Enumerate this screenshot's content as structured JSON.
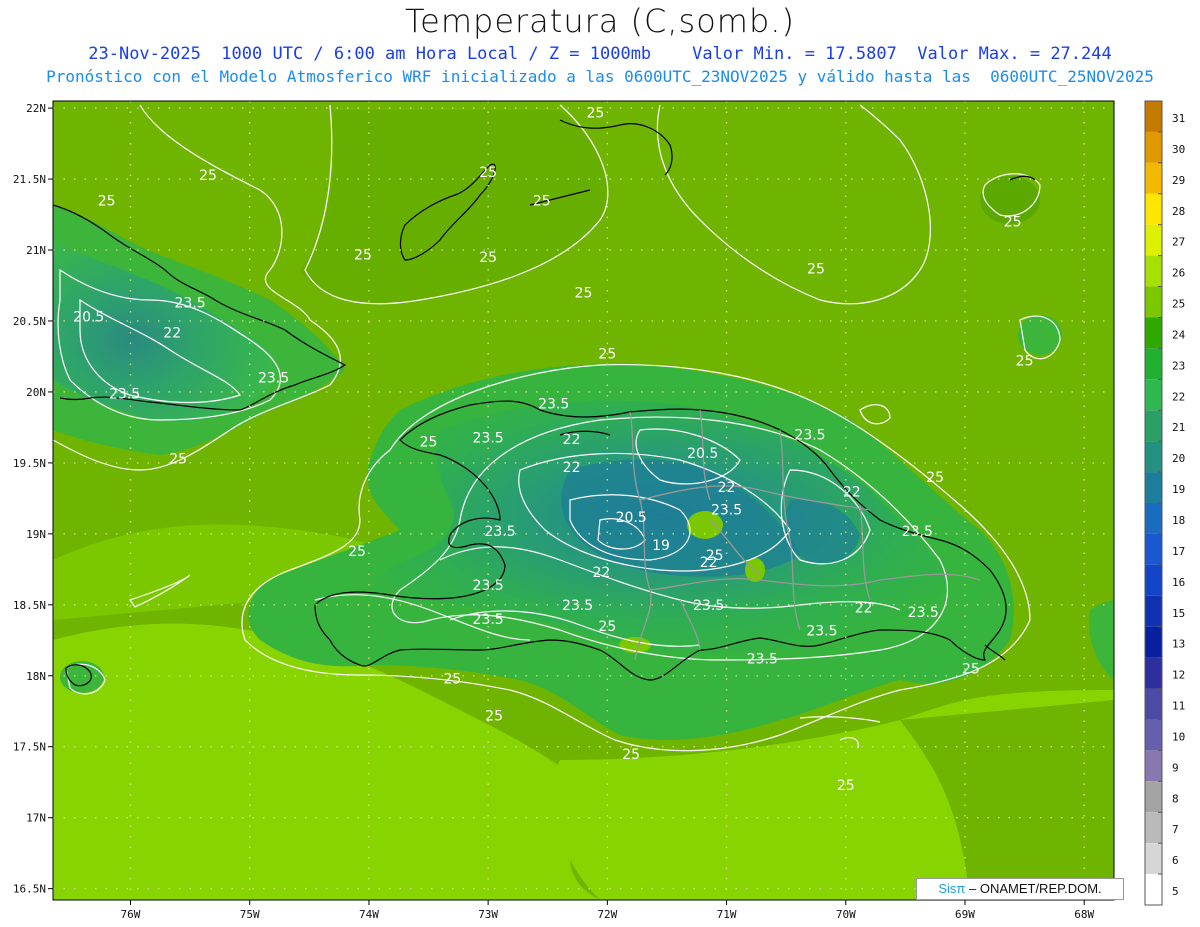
{
  "header": {
    "title": "Temperatura (C,somb.)",
    "subtitle": "23-Nov-2025  1000 UTC / 6:00 am Hora Local / Z = 1000mb    Valor Min. = 17.5807  Valor Max. = 27.244",
    "subtitle2": "Pronóstico con el Modelo Atmosferico WRF inicializado a las 0600UTC_23NOV2025 y válido hasta las  0600UTC_25NOV2025"
  },
  "credit": {
    "sis": "Sisπ",
    "text": "– ONAMET/REP.DOM."
  },
  "map": {
    "lat_labels": [
      "22N",
      "21.5N",
      "21N",
      "20.5N",
      "20N",
      "19.5N",
      "19N",
      "18.5N",
      "18N",
      "17.5N",
      "17N",
      "16.5N"
    ],
    "lon_labels": [
      "76W",
      "75W",
      "74W",
      "73W",
      "72W",
      "71W",
      "70W",
      "69W",
      "68W"
    ],
    "lat_range": [
      16.42,
      22.05
    ],
    "lon_range": [
      -76.65,
      -67.75
    ],
    "grid": true,
    "isotherm_labels": [
      {
        "text": "25",
        "lon": -72.1,
        "lat": 21.97
      },
      {
        "text": "25",
        "lon": -75.35,
        "lat": 21.53
      },
      {
        "text": "25",
        "lon": -73.0,
        "lat": 21.55
      },
      {
        "text": "25",
        "lon": -72.55,
        "lat": 21.35
      },
      {
        "text": "25",
        "lon": -76.2,
        "lat": 21.35
      },
      {
        "text": "25",
        "lon": -68.6,
        "lat": 21.2
      },
      {
        "text": "25",
        "lon": -73.0,
        "lat": 20.95
      },
      {
        "text": "25",
        "lon": -74.05,
        "lat": 20.97
      },
      {
        "text": "25",
        "lon": -70.25,
        "lat": 20.87
      },
      {
        "text": "25",
        "lon": -72.2,
        "lat": 20.7
      },
      {
        "text": "25",
        "lon": -72.0,
        "lat": 20.27
      },
      {
        "text": "25",
        "lon": -68.5,
        "lat": 20.22
      },
      {
        "text": "25",
        "lon": -75.6,
        "lat": 19.53
      },
      {
        "text": "25",
        "lon": -69.25,
        "lat": 19.4
      },
      {
        "text": "25",
        "lon": -73.5,
        "lat": 19.65
      },
      {
        "text": "25",
        "lon": -74.1,
        "lat": 18.88
      },
      {
        "text": "25",
        "lon": -72.0,
        "lat": 18.35
      },
      {
        "text": "25",
        "lon": -71.1,
        "lat": 18.85
      },
      {
        "text": "25",
        "lon": -68.95,
        "lat": 18.05
      },
      {
        "text": "25",
        "lon": -73.3,
        "lat": 17.98
      },
      {
        "text": "25",
        "lon": -72.95,
        "lat": 17.72
      },
      {
        "text": "25",
        "lon": -71.8,
        "lat": 17.45
      },
      {
        "text": "25",
        "lon": -70.0,
        "lat": 17.23
      },
      {
        "text": "23.5",
        "lon": -75.5,
        "lat": 20.63
      },
      {
        "text": "23.5",
        "lon": -74.8,
        "lat": 20.1
      },
      {
        "text": "23.5",
        "lon": -76.05,
        "lat": 19.99
      },
      {
        "text": "23.5",
        "lon": -72.45,
        "lat": 19.92
      },
      {
        "text": "23.5",
        "lon": -73.0,
        "lat": 19.68
      },
      {
        "text": "23.5",
        "lon": -70.3,
        "lat": 19.7
      },
      {
        "text": "23.5",
        "lon": -72.9,
        "lat": 19.02
      },
      {
        "text": "23.5",
        "lon": -73.0,
        "lat": 18.64
      },
      {
        "text": "23.5",
        "lon": -73.0,
        "lat": 18.4
      },
      {
        "text": "23.5",
        "lon": -72.25,
        "lat": 18.5
      },
      {
        "text": "23.5",
        "lon": -71.15,
        "lat": 18.5
      },
      {
        "text": "23.5",
        "lon": -71.0,
        "lat": 19.17
      },
      {
        "text": "23.5",
        "lon": -70.2,
        "lat": 18.32
      },
      {
        "text": "23.5",
        "lon": -70.7,
        "lat": 18.12
      },
      {
        "text": "23.5",
        "lon": -69.4,
        "lat": 19.02
      },
      {
        "text": "23.5",
        "lon": -69.35,
        "lat": 18.45
      },
      {
        "text": "22",
        "lon": -75.65,
        "lat": 20.42
      },
      {
        "text": "22",
        "lon": -72.3,
        "lat": 19.67
      },
      {
        "text": "22",
        "lon": -72.3,
        "lat": 19.47
      },
      {
        "text": "22",
        "lon": -71.0,
        "lat": 19.33
      },
      {
        "text": "22",
        "lon": -69.95,
        "lat": 19.3
      },
      {
        "text": "22",
        "lon": -71.15,
        "lat": 18.8
      },
      {
        "text": "22",
        "lon": -72.05,
        "lat": 18.73
      },
      {
        "text": "22",
        "lon": -69.85,
        "lat": 18.48
      },
      {
        "text": "20.5",
        "lon": -76.35,
        "lat": 20.53
      },
      {
        "text": "20.5",
        "lon": -71.2,
        "lat": 19.57
      },
      {
        "text": "20.5",
        "lon": -71.8,
        "lat": 19.12
      },
      {
        "text": "19",
        "lon": -71.55,
        "lat": 18.92
      }
    ]
  },
  "colorbar": {
    "labels": [
      "31",
      "30",
      "29",
      "28",
      "27",
      "26",
      "25",
      "24",
      "23",
      "22",
      "21",
      "20",
      "19",
      "18",
      "17",
      "16",
      "15",
      "13",
      "12",
      "11",
      "10",
      "9",
      "8",
      "7",
      "6",
      "5"
    ],
    "colors": [
      "#c47a00",
      "#e09a00",
      "#f5b800",
      "#ffe600",
      "#dcf000",
      "#a6e000",
      "#7cc800",
      "#2fa800",
      "#22b033",
      "#30b850",
      "#2ca064",
      "#239080",
      "#1a7e9c",
      "#1a6cc0",
      "#1a58d2",
      "#1444c8",
      "#1032b0",
      "#0a1ea0",
      "#2d2f9e",
      "#4b4ba6",
      "#6660ac",
      "#8878b0",
      "#a4a4a4",
      "#bababa",
      "#d6d6d6",
      "#ffffff"
    ]
  }
}
